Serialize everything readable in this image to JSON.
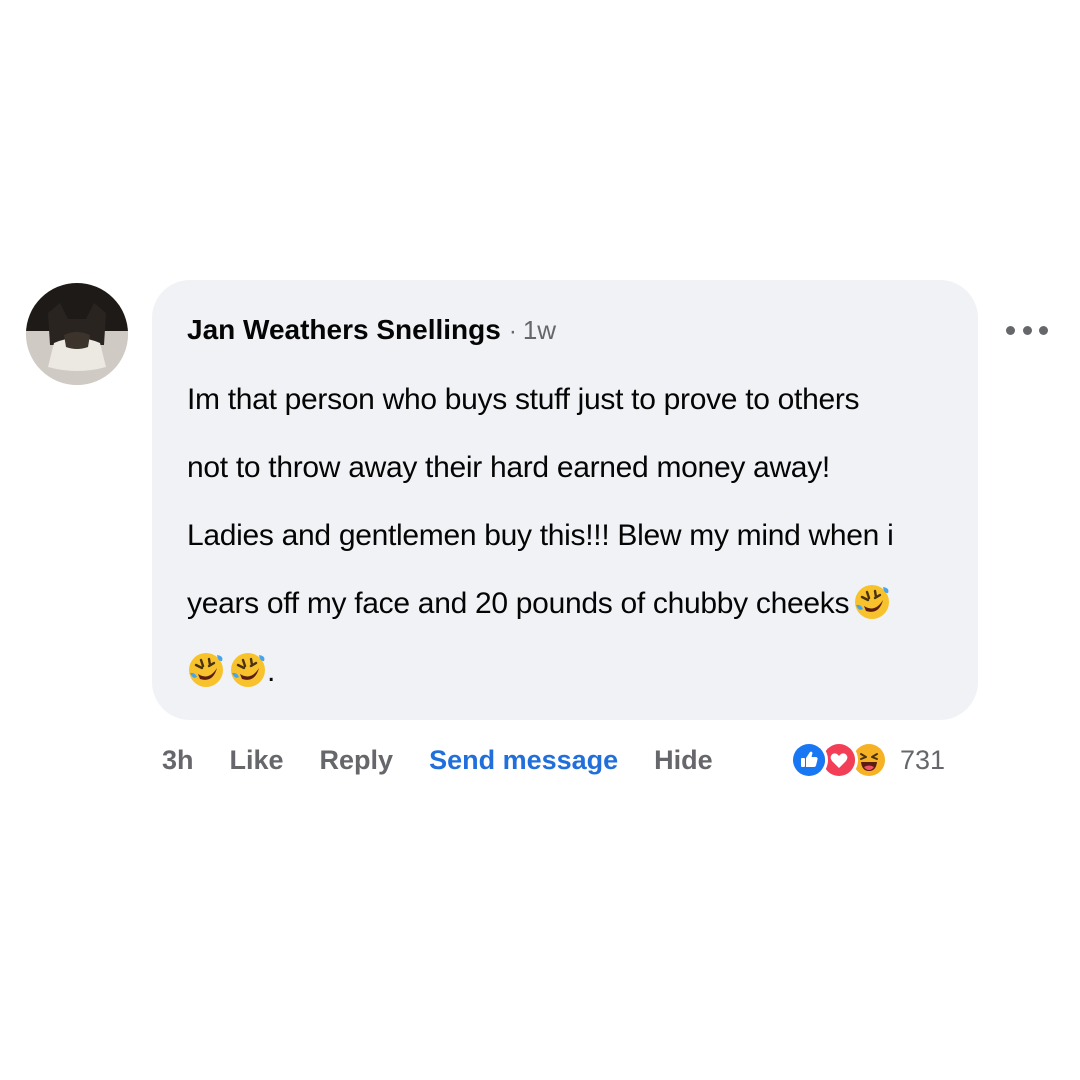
{
  "comment": {
    "author": "Jan Weathers Snellings",
    "separator": "·",
    "timestamp": "1w",
    "lines": [
      "Im that person who buys stuff just to prove to others",
      "not to throw away their hard earned money away!",
      "Ladies and gentlemen buy this!!! Blew my mind when i",
      "years off my face and 20 pounds of chubby cheeks",
      "."
    ],
    "emoji": "rolling-on-floor-laughing-icon"
  },
  "actions": {
    "age": "3h",
    "like": "Like",
    "reply": "Reply",
    "send_message": "Send message",
    "hide": "Hide"
  },
  "reactions": {
    "icons": [
      "like-icon",
      "love-icon",
      "haha-icon"
    ],
    "count": "731"
  },
  "colors": {
    "bubble": "#f0f2f5",
    "link": "#216fdb",
    "secondary_text": "#65676b",
    "like": "#1877f2",
    "love": "#f33e58",
    "haha": "#f7b125"
  }
}
